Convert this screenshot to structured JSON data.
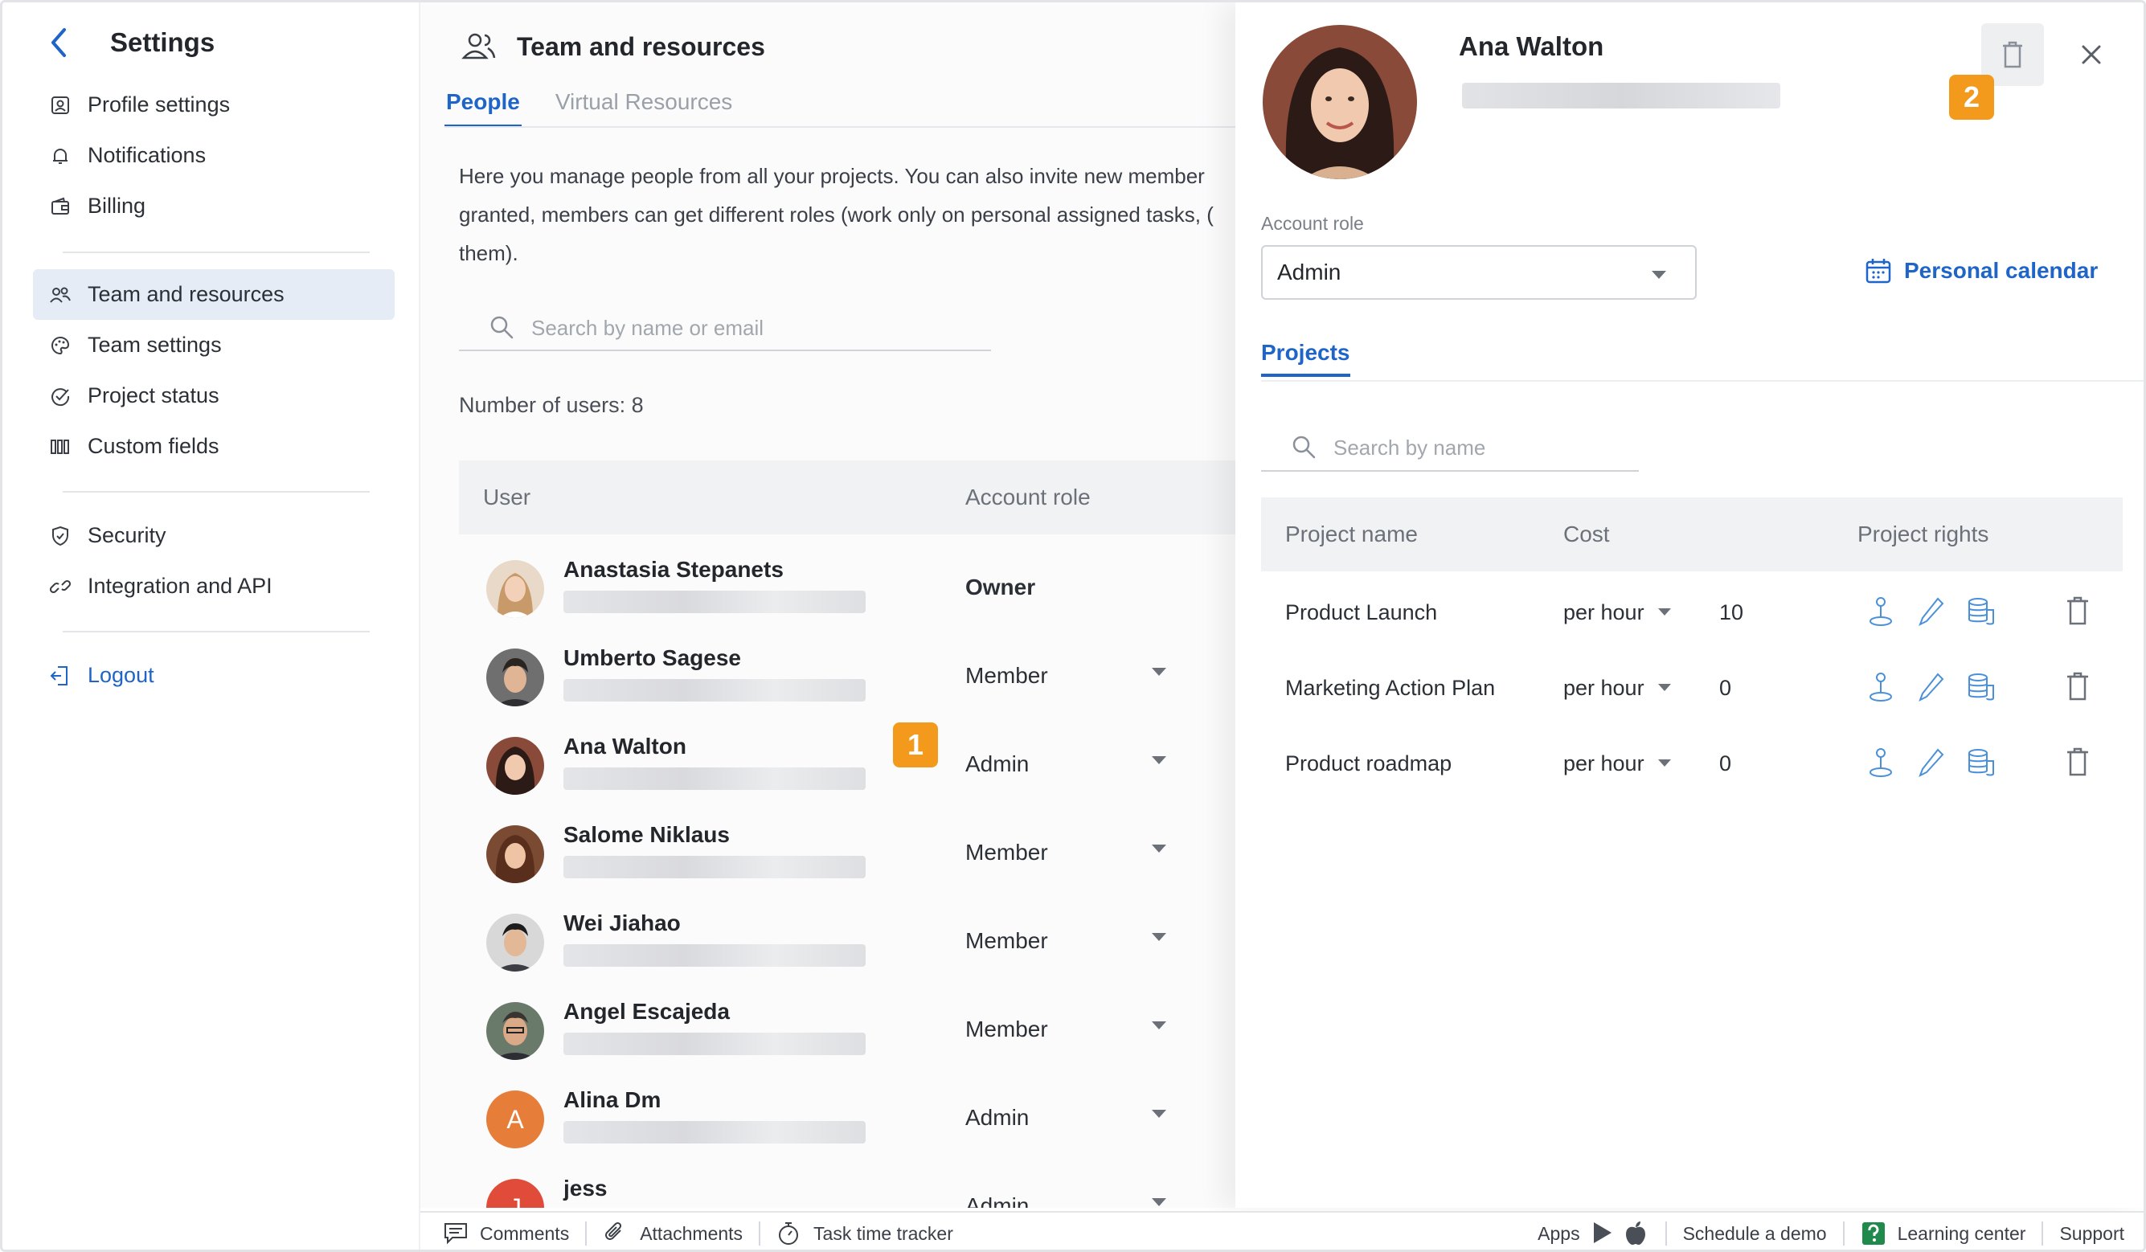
{
  "sidebar": {
    "title": "Settings",
    "group1": [
      {
        "label": "Profile settings",
        "icon": "profile-icon"
      },
      {
        "label": "Notifications",
        "icon": "bell-icon"
      },
      {
        "label": "Billing",
        "icon": "wallet-icon"
      }
    ],
    "group2": [
      {
        "label": "Team and resources",
        "icon": "team-icon",
        "active": true
      },
      {
        "label": "Team settings",
        "icon": "palette-icon"
      },
      {
        "label": "Project status",
        "icon": "check-circle-icon"
      },
      {
        "label": "Custom fields",
        "icon": "columns-icon"
      }
    ],
    "group3": [
      {
        "label": "Security",
        "icon": "shield-icon"
      },
      {
        "label": "Integration and API",
        "icon": "link-icon"
      }
    ],
    "logout": "Logout"
  },
  "main": {
    "title": "Team and resources",
    "tabs": [
      {
        "label": "People",
        "active": true
      },
      {
        "label": "Virtual Resources"
      }
    ],
    "description": [
      "Here you manage people from all your projects. You can also invite new member",
      "granted, members can get different roles (work only on personal assigned tasks, (",
      "them)."
    ],
    "search_placeholder": "Search by name or email",
    "users_count": "Number of users: 8",
    "columns": {
      "user": "User",
      "role": "Account role"
    },
    "users": [
      {
        "name": "Anastasia Stepanets",
        "role": "Owner",
        "owner": true
      },
      {
        "name": "Umberto Sagese",
        "role": "Member"
      },
      {
        "name": "Ana Walton",
        "role": "Admin"
      },
      {
        "name": "Salome Niklaus",
        "role": "Member"
      },
      {
        "name": "Wei Jiahao",
        "role": "Member"
      },
      {
        "name": "Angel Escajeda",
        "role": "Member"
      },
      {
        "name": "Alina Dm",
        "role": "Admin",
        "initial": "A"
      },
      {
        "name": "jess",
        "role": "Admin",
        "initial": "J"
      }
    ]
  },
  "badges": {
    "one": "1",
    "two": "2"
  },
  "panel": {
    "name": "Ana Walton",
    "role_label": "Account role",
    "role_value": "Admin",
    "calendar_label": "Personal calendar",
    "tab": "Projects",
    "search_placeholder": "Search by name",
    "columns": {
      "project": "Project name",
      "cost": "Cost",
      "rights": "Project rights"
    },
    "projects": [
      {
        "name": "Product Launch",
        "cost": "per hour",
        "value": "10"
      },
      {
        "name": "Marketing Action Plan",
        "cost": "per hour",
        "value": "0"
      },
      {
        "name": "Product roadmap",
        "cost": "per hour",
        "value": "0"
      }
    ]
  },
  "footer": {
    "comments": "Comments",
    "attachments": "Attachments",
    "tracker": "Task time tracker",
    "apps": "Apps",
    "demo": "Schedule a demo",
    "learning": "Learning center",
    "support": "Support"
  },
  "colors": {
    "accent": "#1f64c7",
    "badge": "#f39a1c",
    "active_bg": "#e6ecf6",
    "avatar_orange": "#e67e3a",
    "avatar_red": "#e04b3a"
  }
}
